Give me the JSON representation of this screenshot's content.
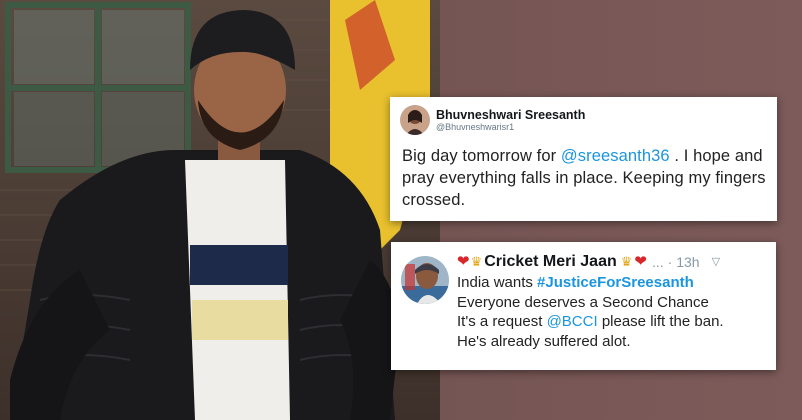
{
  "photo": {
    "description_icon": "person-photo",
    "bg_left": "#4a3a34",
    "bg_right": "#7b5857",
    "flag_color": "#e9c12e"
  },
  "tweet1": {
    "name": "Bhuvneshwari Sreesanth",
    "handle": "@Bhuvneshwarisr1",
    "text_before": "Big day tomorrow for ",
    "mention": "@sreesanth36",
    "text_after": " . I hope and pray everything falls in place. Keeping my fingers crossed."
  },
  "tweet2": {
    "account_name": "Cricket Meri Jaan",
    "more": "...",
    "time": "· 13h",
    "line1_before": "India wants ",
    "hashtag": "#JusticeForSreesanth",
    "line2": "Everyone deserves a Second Chance",
    "line3_before": "It's a request ",
    "mention": "@BCCI",
    "line3_after": " please lift the ban.",
    "line4": "He's already suffered alot."
  },
  "colors": {
    "link": "#1b95e0",
    "heart": "#d9262b",
    "crown": "#e2a715"
  }
}
